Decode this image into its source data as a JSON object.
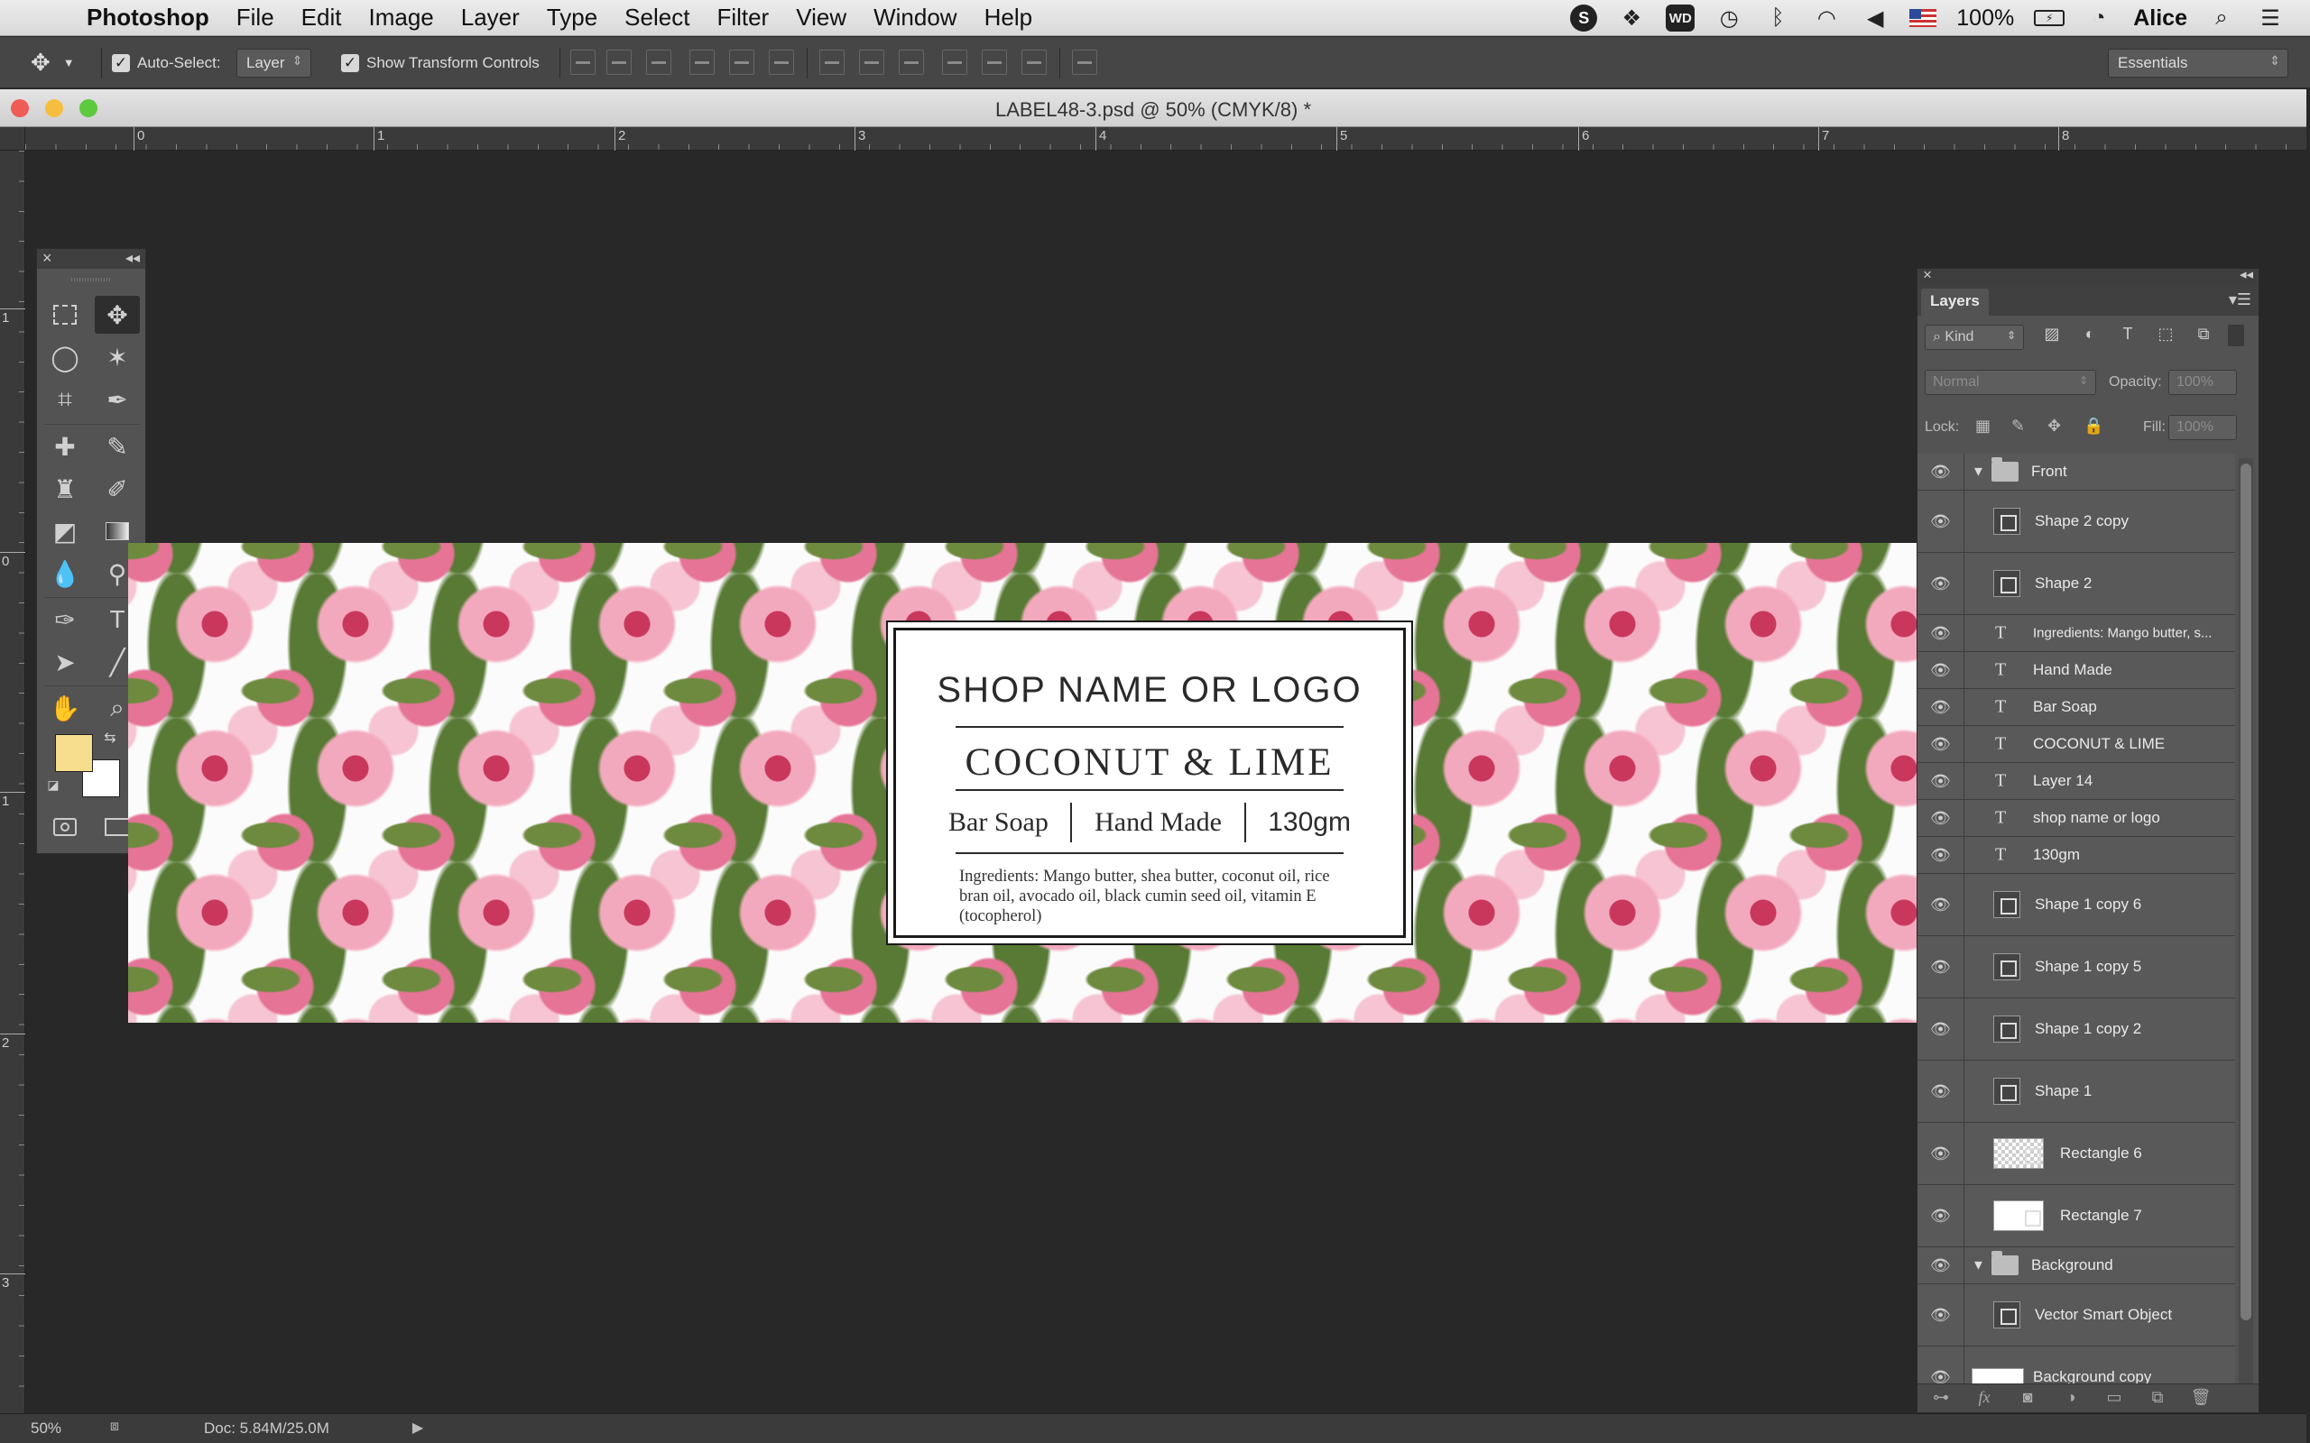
{
  "menubar": {
    "app_name": "Photoshop",
    "menus": [
      "File",
      "Edit",
      "Image",
      "Layer",
      "Type",
      "Select",
      "Filter",
      "View",
      "Window",
      "Help"
    ],
    "battery": "100%",
    "user": "Alice",
    "wd_badge": "WD",
    "skype_badge": "S"
  },
  "options": {
    "auto_select_label": "Auto-Select:",
    "auto_select_value": "Layer",
    "transform_label": "Show Transform Controls",
    "workspace": "Essentials"
  },
  "document": {
    "title": "LABEL48-3.psd @ 50% (CMYK/8) *"
  },
  "rulers": {
    "horizontal": [
      "0",
      "1",
      "2",
      "3",
      "4",
      "5",
      "6",
      "7",
      "8"
    ],
    "vertical": [
      "1",
      "0",
      "1",
      "2",
      "3"
    ]
  },
  "label": {
    "shop": "SHOP NAME OR LOGO",
    "product": "COCONUT & LIME",
    "type": "Bar Soap",
    "made": "Hand Made",
    "weight": "130gm",
    "ingredients": "Ingredients: Mango butter, shea butter, coconut oil, rice bran oil, avocado oil, black cumin seed oil, vitamin E (tocopherol)"
  },
  "layers_panel": {
    "tab": "Layers",
    "filter_kind": "Kind",
    "blend_mode": "Normal",
    "opacity_label": "Opacity:",
    "opacity_value": "100%",
    "lock_label": "Lock:",
    "fill_label": "Fill:",
    "fill_value": "100%",
    "layers": [
      {
        "name": "Front",
        "kind": "group"
      },
      {
        "name": "Shape 2 copy",
        "kind": "shape"
      },
      {
        "name": "Shape 2",
        "kind": "shape"
      },
      {
        "name": "Ingredients: Mango butter, s...",
        "kind": "text"
      },
      {
        "name": "Hand Made",
        "kind": "text"
      },
      {
        "name": "Bar Soap",
        "kind": "text"
      },
      {
        "name": "COCONUT & LIME",
        "kind": "text"
      },
      {
        "name": "Layer 14",
        "kind": "text"
      },
      {
        "name": "shop name or logo",
        "kind": "text"
      },
      {
        "name": "130gm",
        "kind": "text"
      },
      {
        "name": "Shape 1 copy 6",
        "kind": "shape"
      },
      {
        "name": "Shape 1 copy 5",
        "kind": "shape"
      },
      {
        "name": "Shape 1 copy 2",
        "kind": "shape"
      },
      {
        "name": "Shape 1",
        "kind": "shape"
      },
      {
        "name": "Rectangle 6",
        "kind": "rect-checker"
      },
      {
        "name": "Rectangle 7",
        "kind": "rect-white"
      },
      {
        "name": "Background",
        "kind": "group"
      },
      {
        "name": "Vector Smart Object",
        "kind": "smart"
      },
      {
        "name": "Background copy",
        "kind": "bg"
      }
    ]
  },
  "status": {
    "zoom": "50%",
    "doc": "Doc: 5.84M/25.0M"
  },
  "colors": {
    "foreground": "#f7dd8e",
    "background": "#ffffff",
    "close": "#ee5c55",
    "minimize": "#f6be3f",
    "zoom": "#5fc93f"
  }
}
